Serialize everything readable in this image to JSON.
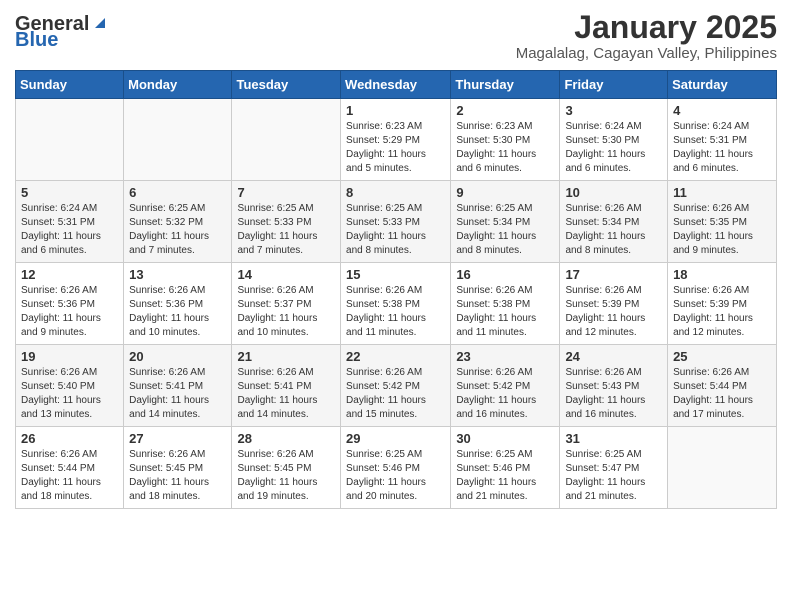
{
  "header": {
    "logo_general": "General",
    "logo_blue": "Blue",
    "title": "January 2025",
    "subtitle": "Magalalag, Cagayan Valley, Philippines"
  },
  "days_of_week": [
    "Sunday",
    "Monday",
    "Tuesday",
    "Wednesday",
    "Thursday",
    "Friday",
    "Saturday"
  ],
  "weeks": [
    [
      {
        "day": "",
        "info": ""
      },
      {
        "day": "",
        "info": ""
      },
      {
        "day": "",
        "info": ""
      },
      {
        "day": "1",
        "info": "Sunrise: 6:23 AM\nSunset: 5:29 PM\nDaylight: 11 hours\nand 5 minutes."
      },
      {
        "day": "2",
        "info": "Sunrise: 6:23 AM\nSunset: 5:30 PM\nDaylight: 11 hours\nand 6 minutes."
      },
      {
        "day": "3",
        "info": "Sunrise: 6:24 AM\nSunset: 5:30 PM\nDaylight: 11 hours\nand 6 minutes."
      },
      {
        "day": "4",
        "info": "Sunrise: 6:24 AM\nSunset: 5:31 PM\nDaylight: 11 hours\nand 6 minutes."
      }
    ],
    [
      {
        "day": "5",
        "info": "Sunrise: 6:24 AM\nSunset: 5:31 PM\nDaylight: 11 hours\nand 6 minutes."
      },
      {
        "day": "6",
        "info": "Sunrise: 6:25 AM\nSunset: 5:32 PM\nDaylight: 11 hours\nand 7 minutes."
      },
      {
        "day": "7",
        "info": "Sunrise: 6:25 AM\nSunset: 5:33 PM\nDaylight: 11 hours\nand 7 minutes."
      },
      {
        "day": "8",
        "info": "Sunrise: 6:25 AM\nSunset: 5:33 PM\nDaylight: 11 hours\nand 8 minutes."
      },
      {
        "day": "9",
        "info": "Sunrise: 6:25 AM\nSunset: 5:34 PM\nDaylight: 11 hours\nand 8 minutes."
      },
      {
        "day": "10",
        "info": "Sunrise: 6:26 AM\nSunset: 5:34 PM\nDaylight: 11 hours\nand 8 minutes."
      },
      {
        "day": "11",
        "info": "Sunrise: 6:26 AM\nSunset: 5:35 PM\nDaylight: 11 hours\nand 9 minutes."
      }
    ],
    [
      {
        "day": "12",
        "info": "Sunrise: 6:26 AM\nSunset: 5:36 PM\nDaylight: 11 hours\nand 9 minutes."
      },
      {
        "day": "13",
        "info": "Sunrise: 6:26 AM\nSunset: 5:36 PM\nDaylight: 11 hours\nand 10 minutes."
      },
      {
        "day": "14",
        "info": "Sunrise: 6:26 AM\nSunset: 5:37 PM\nDaylight: 11 hours\nand 10 minutes."
      },
      {
        "day": "15",
        "info": "Sunrise: 6:26 AM\nSunset: 5:38 PM\nDaylight: 11 hours\nand 11 minutes."
      },
      {
        "day": "16",
        "info": "Sunrise: 6:26 AM\nSunset: 5:38 PM\nDaylight: 11 hours\nand 11 minutes."
      },
      {
        "day": "17",
        "info": "Sunrise: 6:26 AM\nSunset: 5:39 PM\nDaylight: 11 hours\nand 12 minutes."
      },
      {
        "day": "18",
        "info": "Sunrise: 6:26 AM\nSunset: 5:39 PM\nDaylight: 11 hours\nand 12 minutes."
      }
    ],
    [
      {
        "day": "19",
        "info": "Sunrise: 6:26 AM\nSunset: 5:40 PM\nDaylight: 11 hours\nand 13 minutes."
      },
      {
        "day": "20",
        "info": "Sunrise: 6:26 AM\nSunset: 5:41 PM\nDaylight: 11 hours\nand 14 minutes."
      },
      {
        "day": "21",
        "info": "Sunrise: 6:26 AM\nSunset: 5:41 PM\nDaylight: 11 hours\nand 14 minutes."
      },
      {
        "day": "22",
        "info": "Sunrise: 6:26 AM\nSunset: 5:42 PM\nDaylight: 11 hours\nand 15 minutes."
      },
      {
        "day": "23",
        "info": "Sunrise: 6:26 AM\nSunset: 5:42 PM\nDaylight: 11 hours\nand 16 minutes."
      },
      {
        "day": "24",
        "info": "Sunrise: 6:26 AM\nSunset: 5:43 PM\nDaylight: 11 hours\nand 16 minutes."
      },
      {
        "day": "25",
        "info": "Sunrise: 6:26 AM\nSunset: 5:44 PM\nDaylight: 11 hours\nand 17 minutes."
      }
    ],
    [
      {
        "day": "26",
        "info": "Sunrise: 6:26 AM\nSunset: 5:44 PM\nDaylight: 11 hours\nand 18 minutes."
      },
      {
        "day": "27",
        "info": "Sunrise: 6:26 AM\nSunset: 5:45 PM\nDaylight: 11 hours\nand 18 minutes."
      },
      {
        "day": "28",
        "info": "Sunrise: 6:26 AM\nSunset: 5:45 PM\nDaylight: 11 hours\nand 19 minutes."
      },
      {
        "day": "29",
        "info": "Sunrise: 6:25 AM\nSunset: 5:46 PM\nDaylight: 11 hours\nand 20 minutes."
      },
      {
        "day": "30",
        "info": "Sunrise: 6:25 AM\nSunset: 5:46 PM\nDaylight: 11 hours\nand 21 minutes."
      },
      {
        "day": "31",
        "info": "Sunrise: 6:25 AM\nSunset: 5:47 PM\nDaylight: 11 hours\nand 21 minutes."
      },
      {
        "day": "",
        "info": ""
      }
    ]
  ]
}
